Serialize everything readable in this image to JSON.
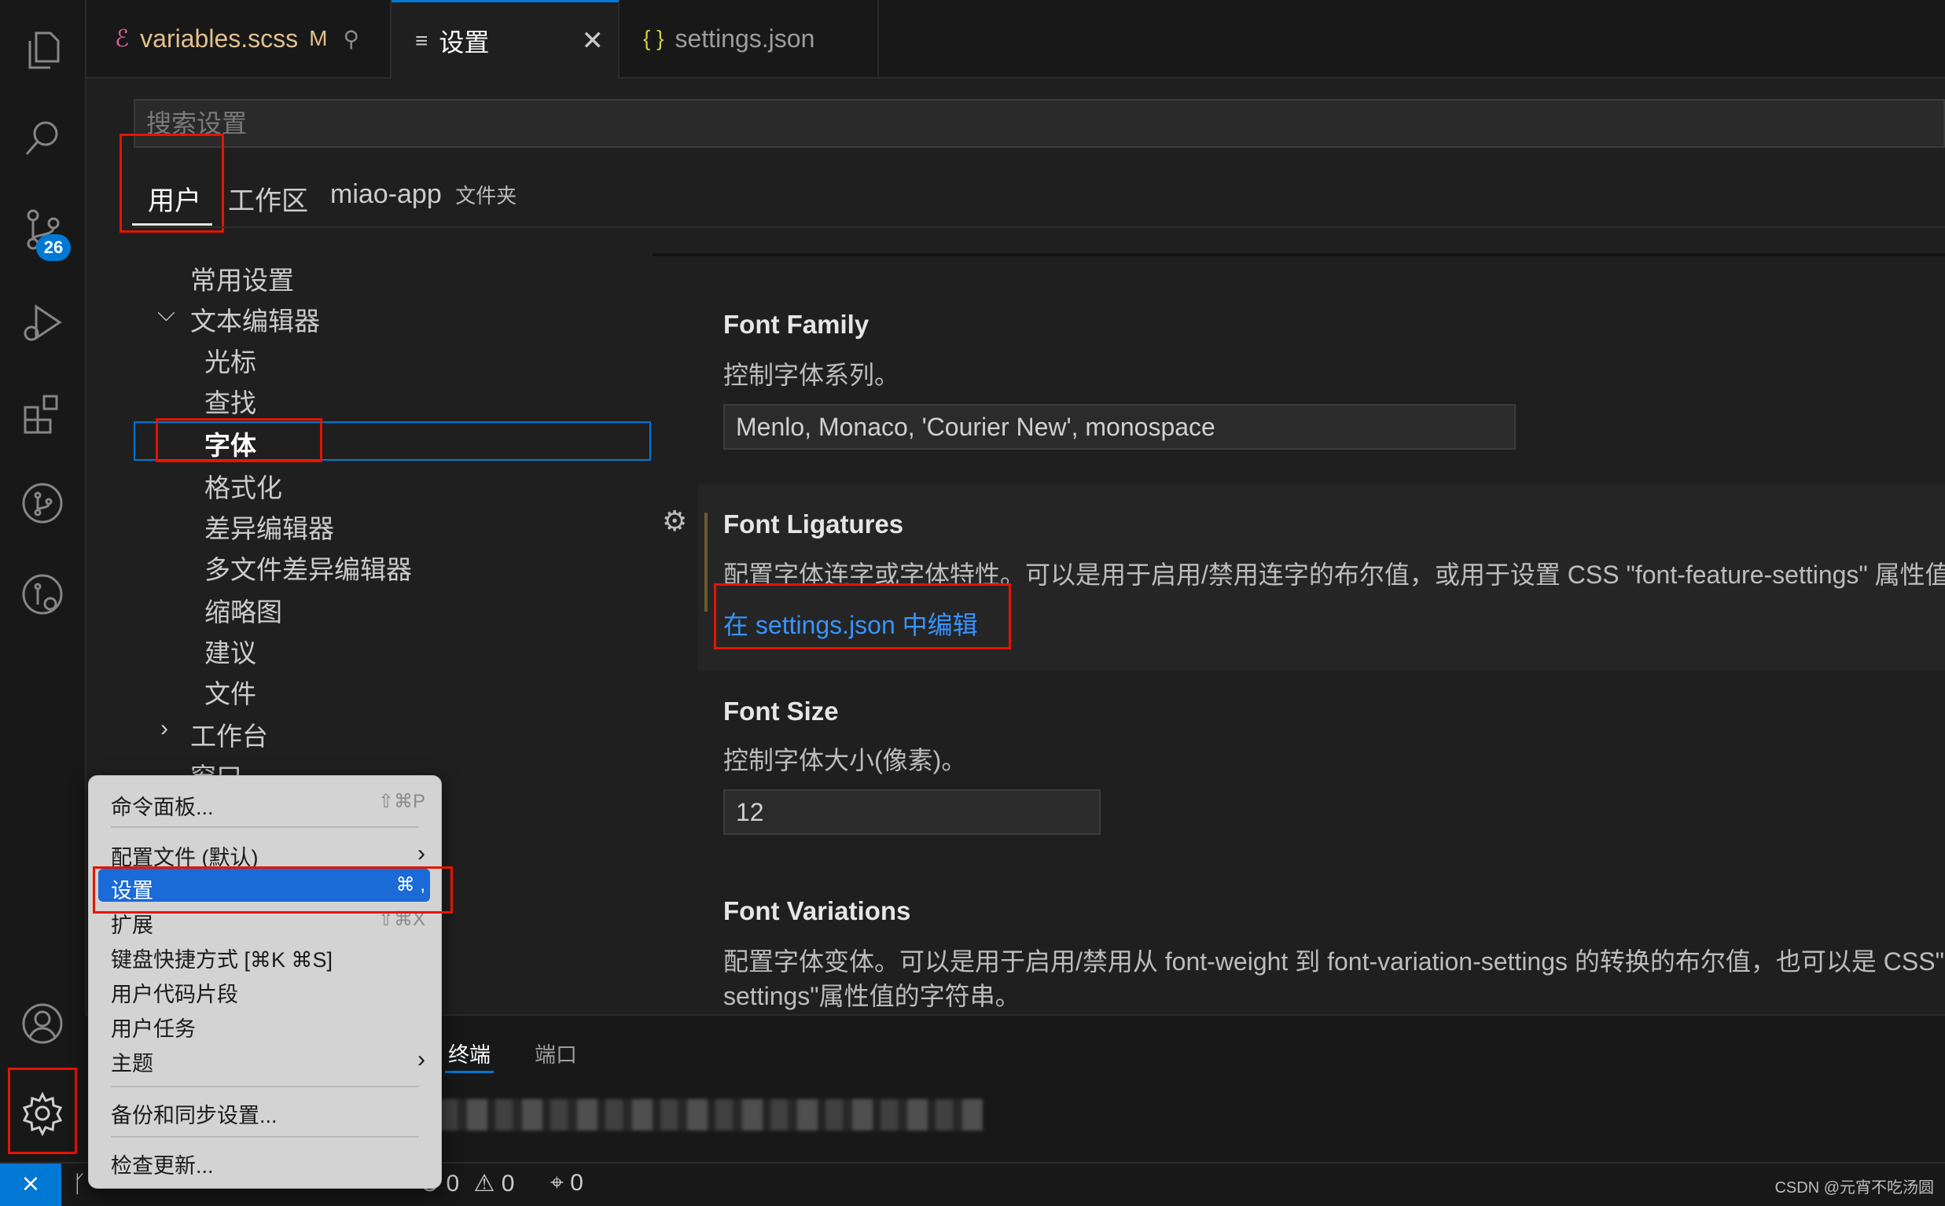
{
  "tabs": [
    {
      "label": "variables.scss",
      "suffix": "M"
    },
    {
      "label": "设置"
    },
    {
      "label": "settings.json"
    }
  ],
  "search": {
    "placeholder": "搜索设置"
  },
  "scopes": {
    "user": "用户",
    "workspace": "工作区",
    "folder": "miao-app",
    "folder_tag": "文件夹"
  },
  "activity": {
    "badge": "26"
  },
  "tree": {
    "common": "常用设置",
    "text_editor": "文本编辑器",
    "cursor": "光标",
    "find": "查找",
    "font": "字体",
    "formatting": "格式化",
    "diff_editor": "差异编辑器",
    "multi_diff": "多文件差异编辑器",
    "minimap": "缩略图",
    "suggestions": "建议",
    "files": "文件",
    "workbench": "工作台",
    "window": "窗口"
  },
  "settings": {
    "font_family": {
      "title": "Font Family",
      "desc": "控制字体系列。",
      "value": "Menlo, Monaco, 'Courier New', monospace"
    },
    "font_ligatures": {
      "title": "Font Ligatures",
      "desc": "配置字体连字或字体特性。可以是用于启用/禁用连字的布尔值，或用于设置 CSS \"font-feature-settings\" 属性值",
      "link": "在 settings.json 中编辑"
    },
    "font_size": {
      "title": "Font Size",
      "desc": "控制字体大小(像素)。",
      "value": "12"
    },
    "font_variations": {
      "title": "Font Variations",
      "desc1": "配置字体变体。可以是用于启用/禁用从 font-weight 到 font-variation-settings 的转换的布尔值，也可以是 CSS\"",
      "desc2": "settings\"属性值的字符串。"
    }
  },
  "panel": {
    "terminal": "终端",
    "ports": "端口"
  },
  "menu": {
    "command_palette": "命令面板...",
    "command_palette_key": "⇧⌘P",
    "profiles": "配置文件 (默认)",
    "settings": "设置",
    "settings_key": "⌘ ,",
    "extensions": "扩展",
    "extensions_key": "⇧⌘X",
    "keyboard": "键盘快捷方式 [⌘K ⌘S]",
    "snippets": "用户代码片段",
    "tasks": "用户任务",
    "themes": "主题",
    "backup": "备份和同步设置...",
    "updates": "检查更新..."
  },
  "status": {
    "errors": "0",
    "warnings": "0",
    "ports": "0",
    "watermark": "CSDN @元宵不吃汤圆"
  },
  "colors": {
    "accent": "#0078d4",
    "highlight": "#e51400",
    "link": "#3794ff",
    "menu_selected": "#1a6ad8"
  }
}
